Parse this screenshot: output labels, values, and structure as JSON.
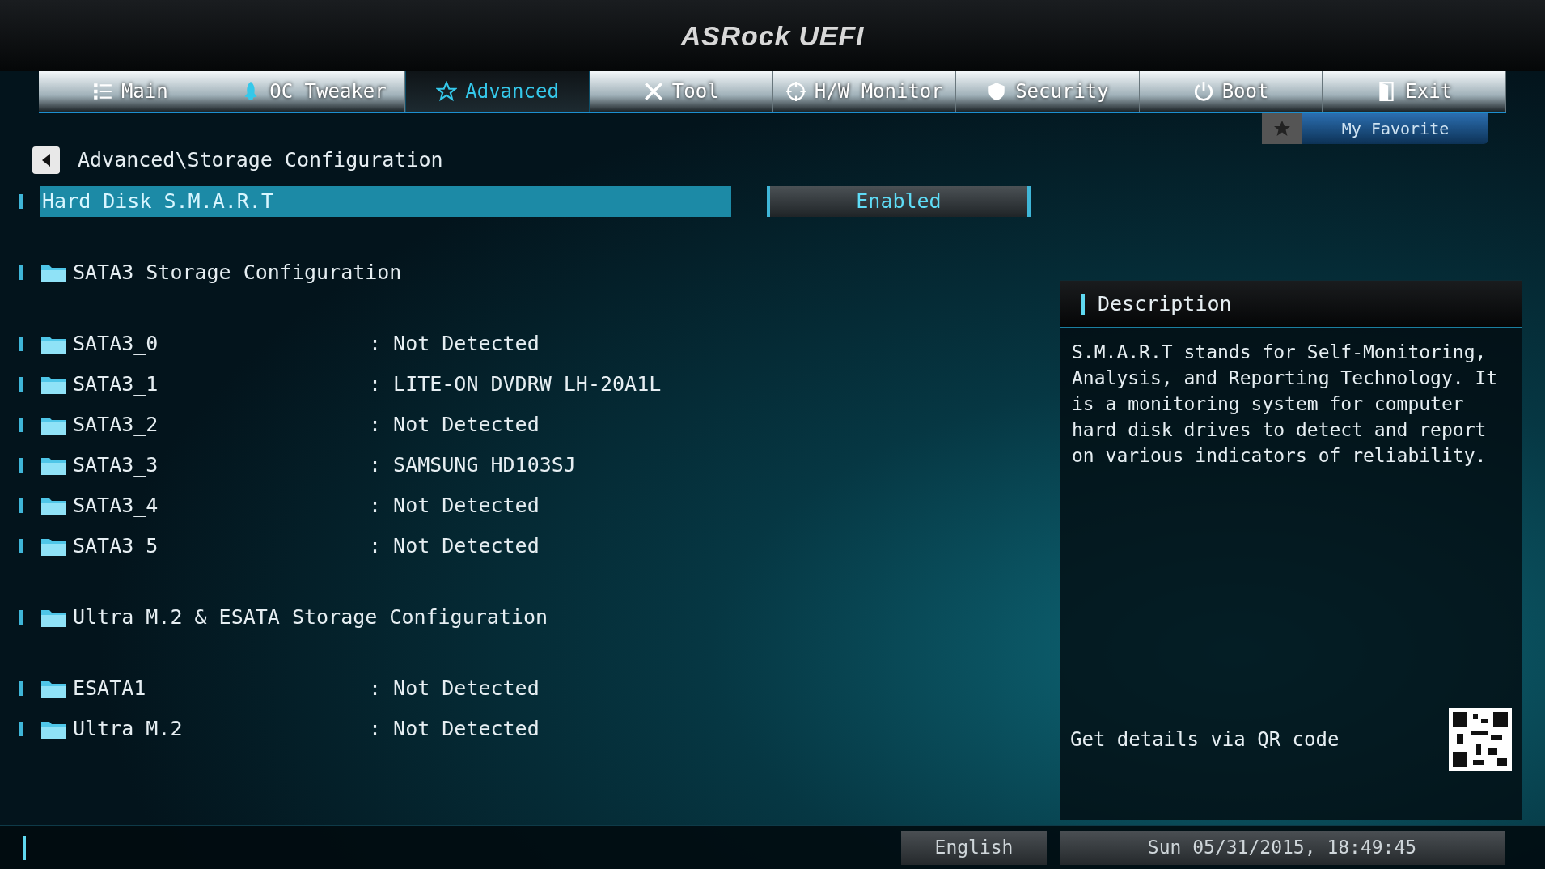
{
  "header": {
    "title": "ASRock UEFI"
  },
  "tabs": [
    {
      "label": "Main",
      "selected": false
    },
    {
      "label": "OC Tweaker",
      "selected": false
    },
    {
      "label": "Advanced",
      "selected": true
    },
    {
      "label": "Tool",
      "selected": false
    },
    {
      "label": "H/W Monitor",
      "selected": false
    },
    {
      "label": "Security",
      "selected": false
    },
    {
      "label": "Boot",
      "selected": false
    },
    {
      "label": "Exit",
      "selected": false
    }
  ],
  "favorite": {
    "label": "My Favorite"
  },
  "breadcrumb": "Advanced\\Storage Configuration",
  "groups": [
    {
      "items": [
        {
          "kind": "option",
          "label": "Hard Disk S.M.A.R.T",
          "value": "Enabled",
          "selected": true
        }
      ]
    },
    {
      "items": [
        {
          "kind": "folder",
          "label": "SATA3 Storage Configuration",
          "selected": false
        }
      ]
    },
    {
      "items": [
        {
          "kind": "folder",
          "label": "SATA3_0",
          "value": ": Not Detected",
          "selected": false
        },
        {
          "kind": "folder",
          "label": "SATA3_1",
          "value": ": LITE-ON DVDRW LH-20A1L",
          "selected": false
        },
        {
          "kind": "folder",
          "label": "SATA3_2",
          "value": ": Not Detected",
          "selected": false
        },
        {
          "kind": "folder",
          "label": "SATA3_3",
          "value": ": SAMSUNG HD103SJ",
          "selected": false
        },
        {
          "kind": "folder",
          "label": "SATA3_4",
          "value": ": Not Detected",
          "selected": false
        },
        {
          "kind": "folder",
          "label": "SATA3_5",
          "value": ": Not Detected",
          "selected": false
        }
      ]
    },
    {
      "items": [
        {
          "kind": "folder",
          "label": "Ultra M.2 & ESATA Storage Configuration",
          "selected": false
        }
      ]
    },
    {
      "items": [
        {
          "kind": "folder",
          "label": "ESATA1",
          "value": ": Not Detected",
          "selected": false
        },
        {
          "kind": "folder",
          "label": "Ultra M.2",
          "value": ": Not Detected",
          "selected": false
        }
      ]
    }
  ],
  "description": {
    "title": "Description",
    "text": "S.M.A.R.T stands for Self-Monitoring, Analysis, and Reporting Technology. It is a monitoring system for computer hard disk drives to detect and report on various indicators of reliability.",
    "qr_label": "Get details via QR code"
  },
  "status_bar": {
    "language": "English",
    "datetime": "Sun 05/31/2015, 18:49:45"
  }
}
